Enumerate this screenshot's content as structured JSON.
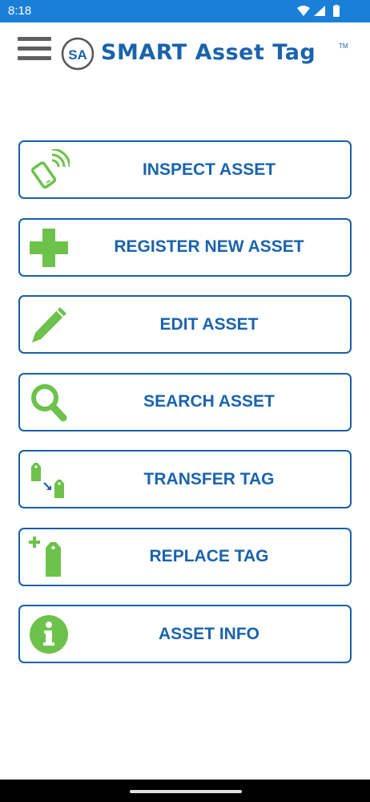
{
  "status_bar": {
    "time": "8:18",
    "icons": [
      "wifi-icon",
      "signal-icon",
      "battery-icon"
    ]
  },
  "header": {
    "logo_mark": "SA",
    "app_title": "SMART Asset Tag",
    "trademark": "TM"
  },
  "colors": {
    "status_bar": "#1a7fd6",
    "accent_blue": "#1a63ad",
    "button_border": "#1a5fa8",
    "icon_green": "#6cc24a",
    "menu_icon": "#606060"
  },
  "menu": [
    {
      "label": "INSPECT ASSET",
      "icon": "phone-nfc-icon"
    },
    {
      "label": "REGISTER NEW ASSET",
      "icon": "plus-icon"
    },
    {
      "label": "EDIT ASSET",
      "icon": "pencil-icon"
    },
    {
      "label": "SEARCH ASSET",
      "icon": "magnifier-icon"
    },
    {
      "label": "TRANSFER TAG",
      "icon": "tag-transfer-icon"
    },
    {
      "label": "REPLACE TAG",
      "icon": "tag-replace-icon"
    },
    {
      "label": "ASSET INFO",
      "icon": "info-icon"
    }
  ]
}
